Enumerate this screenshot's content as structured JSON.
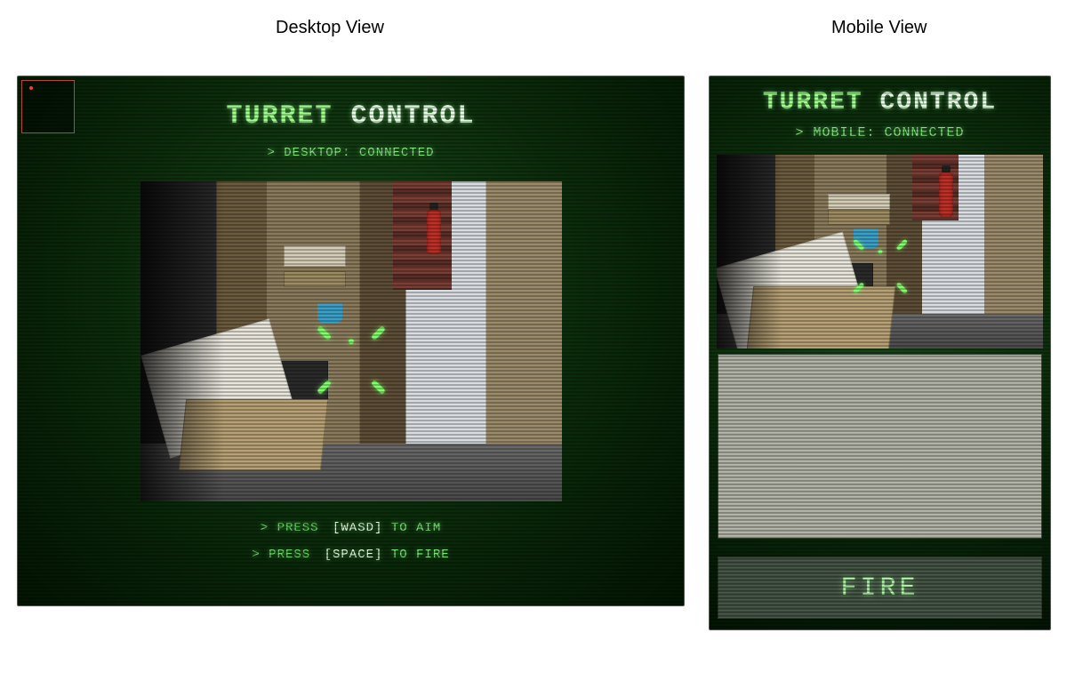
{
  "labels": {
    "desktop_view": "Desktop View",
    "mobile_view": "Mobile View"
  },
  "app": {
    "title_word1": "TURRET",
    "title_word2": "CONTROL"
  },
  "desktop": {
    "status_prefix": "> DESKTOP:",
    "status_value": "CONNECTED",
    "hint1_prefix": "> PRESS",
    "hint1_key": "[WASD]",
    "hint1_suffix": "TO AIM",
    "hint2_prefix": "> PRESS",
    "hint2_key": "[SPACE]",
    "hint2_suffix": "TO FIRE"
  },
  "mobile": {
    "status_prefix": "> MOBILE:",
    "status_value": "CONNECTED",
    "fire_label": "FIRE"
  },
  "colors": {
    "accent_green": "#7fff6a",
    "text_green": "#79e874",
    "panel_dark": "#031403",
    "minimap_border": "#b24a2d",
    "marker_red": "#ff3b1f"
  }
}
